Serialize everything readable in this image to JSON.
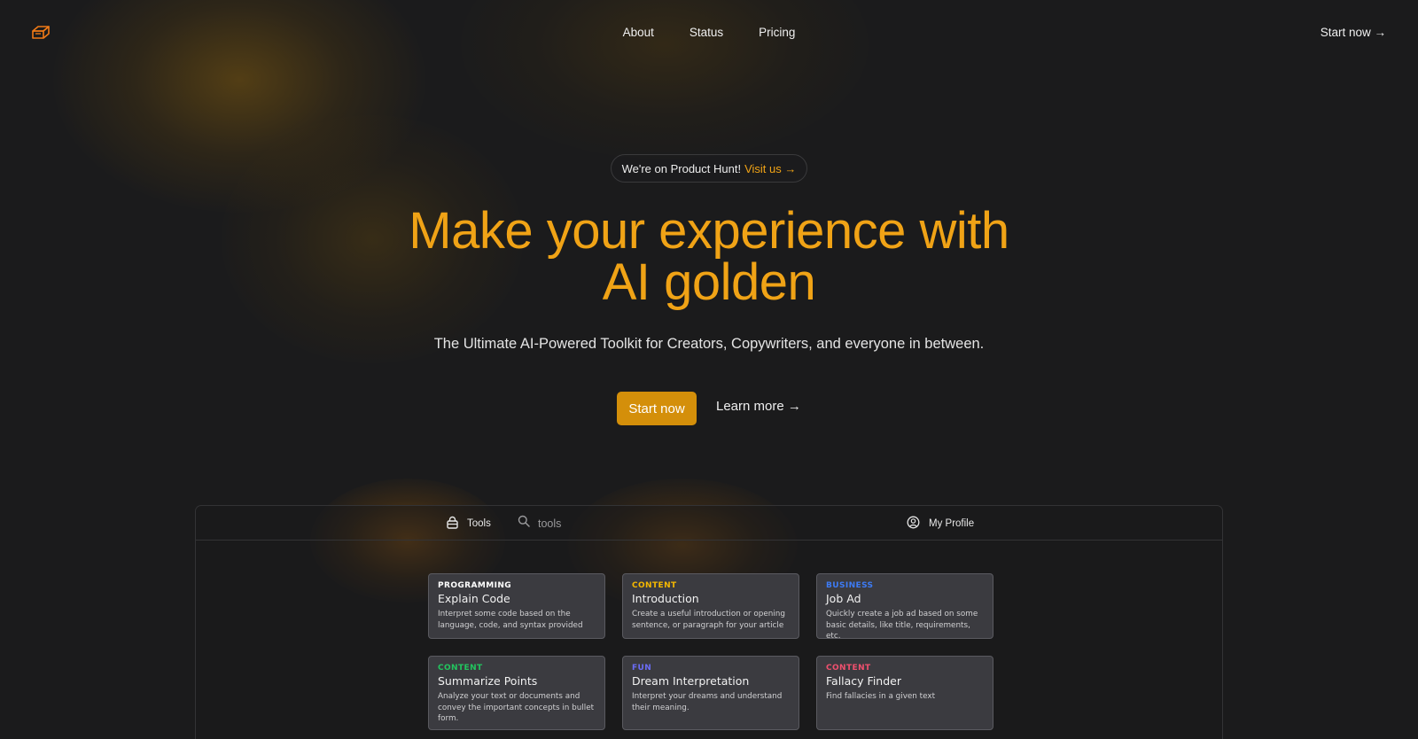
{
  "nav": {
    "links": [
      "About",
      "Status",
      "Pricing"
    ],
    "cta": "Start now →",
    "logo_icon": "brick-logo-icon"
  },
  "hero": {
    "pill_text": "We're on Product Hunt!",
    "pill_link": "Visit us →",
    "title_line1": "Make your experience with",
    "title_line2": "AI golden",
    "subtitle": "The Ultimate AI-Powered Toolkit for Creators, Copywriters, and everyone in between.",
    "primary_button": "Start now",
    "secondary_button": "Learn more →"
  },
  "app": {
    "tools_tab": "Tools",
    "search_placeholder": "tools",
    "profile_label": "My Profile",
    "cards": [
      {
        "category": "PROGRAMMING",
        "category_color": "#ffffff",
        "title": "Explain Code",
        "description": "Interpret some code based on the language, code, and syntax provided"
      },
      {
        "category": "CONTENT",
        "category_color": "#f5b800",
        "title": "Introduction",
        "description": "Create a useful introduction or opening sentence, or paragraph for your article"
      },
      {
        "category": "BUSINESS",
        "category_color": "#3d7bf5",
        "title": "Job Ad",
        "description": "Quickly create a job ad based on some basic details, like title, requirements, etc."
      },
      {
        "category": "CONTENT",
        "category_color": "#22c55e",
        "title": "Summarize Points",
        "description": "Analyze your text or documents and convey the important concepts in bullet form."
      },
      {
        "category": "FUN",
        "category_color": "#6b6cf5",
        "title": "Dream Interpretation",
        "description": "Interpret your dreams and understand their meaning."
      },
      {
        "category": "CONTENT",
        "category_color": "#f0506e",
        "title": "Fallacy Finder",
        "description": "Find fallacies in a given text"
      }
    ]
  },
  "colors": {
    "accent": "#f0a316",
    "button": "#d48f0a",
    "background": "#1b1b1c",
    "card": "#3b3b40"
  }
}
